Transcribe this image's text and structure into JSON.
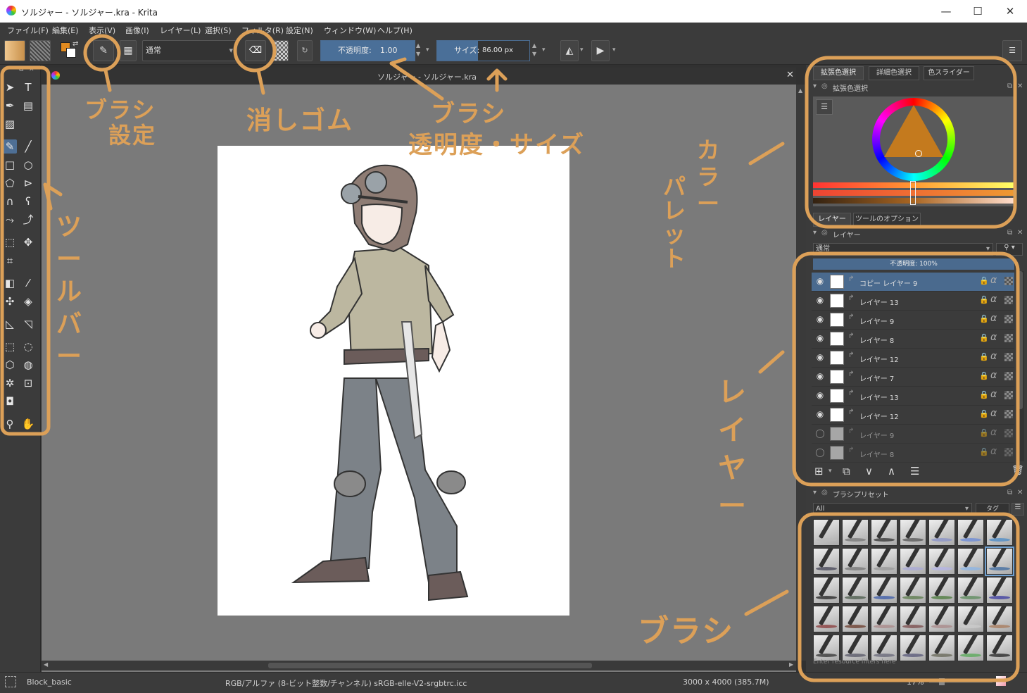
{
  "window": {
    "title": "ソルジャー - ソルジャー.kra  - Krita",
    "minimize": "—",
    "maximize": "☐",
    "close": "✕"
  },
  "menu": [
    "ファイル(F)",
    "編集(E)",
    "表示(V)",
    "画像(I)",
    "レイヤー(L)",
    "選択(S)",
    "フィルタ(R)",
    "設定(N)",
    "ウィンドウ(W)",
    "ヘルプ(H)"
  ],
  "toolbar": {
    "blend_mode": "通常",
    "opacity_label": "不透明度:",
    "opacity_value": "1.00",
    "opacity_fraction": 1.0,
    "size_label": "サイズ:",
    "size_value": "86.00 px"
  },
  "document": {
    "tab_title": "ソルジャー - ソルジャー.kra"
  },
  "dock": {
    "color_tabs": [
      "拡張色選択",
      "詳細色選択",
      "色スライダー"
    ],
    "color_panel_title": "拡張色選択",
    "layer_tabs": [
      "レイヤー",
      "ツールのオプション"
    ],
    "layers_title": "レイヤー",
    "layer_blend": "通常",
    "layer_opacity": "不透明度: 100%",
    "layers": [
      {
        "name": "コピー レイヤー 9",
        "visible": true,
        "selected": true
      },
      {
        "name": "レイヤー 13",
        "visible": true
      },
      {
        "name": "レイヤー 9",
        "visible": true
      },
      {
        "name": "レイヤー 8",
        "visible": true
      },
      {
        "name": "レイヤー 12",
        "visible": true
      },
      {
        "name": "レイヤー 7",
        "visible": true
      },
      {
        "name": "レイヤー 13",
        "visible": true
      },
      {
        "name": "レイヤー 12",
        "visible": true
      },
      {
        "name": "レイヤー 9",
        "visible": false
      },
      {
        "name": "レイヤー 8",
        "visible": false
      }
    ],
    "presets_title": "ブラシプリセット",
    "preset_filter": "All",
    "tag_label": "タグ",
    "resource_filter_placeholder": "Enter resource filters here"
  },
  "status": {
    "brush": "Block_basic",
    "color_profile": "RGB/アルファ (8-ビット整数/チャンネル)  sRGB-elle-V2-srgbtrc.icc",
    "dimensions": "3000 x 4000 (385.7M)",
    "zoom": "17%"
  },
  "annotations": {
    "brush_settings": [
      "ブラシ",
      "設定"
    ],
    "eraser": "消しゴム",
    "opacity_size": [
      "ブラシ",
      "透明度・サイズ"
    ],
    "toolbar": "ツールバー",
    "color_palette": [
      "カラー",
      "パレット"
    ],
    "layers": "レイヤー",
    "brush": "ブラシ",
    "color": "#dca058"
  }
}
